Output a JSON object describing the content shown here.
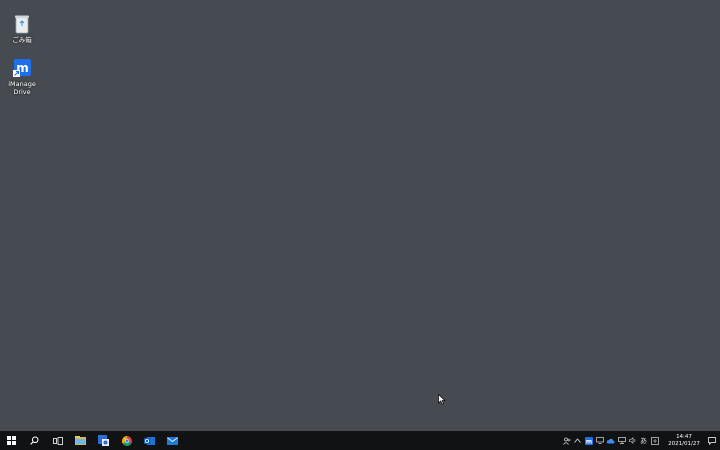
{
  "desktop": {
    "icons": [
      {
        "label": "ごみ箱",
        "icon": "recycle-bin-icon"
      },
      {
        "label": "iManage Drive",
        "icon": "imanage-drive-icon"
      }
    ]
  },
  "taskbar": {
    "apps": [
      "windows-start-icon",
      "search-icon",
      "task-view-icon",
      "file-explorer-icon",
      "app-icon",
      "chrome-icon",
      "outlook-icon",
      "mail-icon"
    ],
    "tray": {
      "ime_label": "あ",
      "time": "14:47",
      "date": "2021/01/27"
    }
  },
  "colors": {
    "desktop_bg": "#464b51",
    "taskbar_bg": "#101214",
    "accent_blue": "#1f6feb"
  }
}
